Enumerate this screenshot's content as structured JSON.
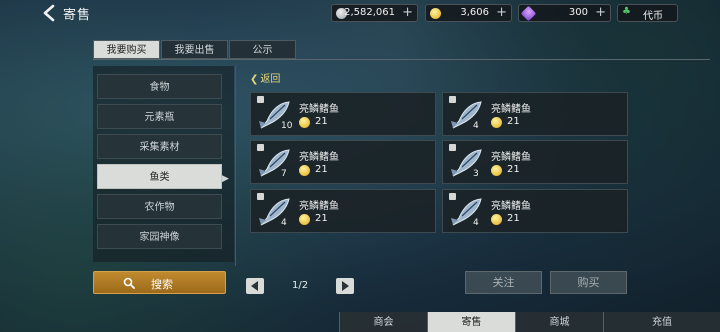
{
  "header": {
    "title": "寄售"
  },
  "currencies": [
    {
      "icon": "silver-coin-icon",
      "value": "2,582,061"
    },
    {
      "icon": "gold-coin-icon",
      "value": "3,606"
    },
    {
      "icon": "purple-gem-icon",
      "value": "300"
    },
    {
      "icon": "clover-icon",
      "value": "代币"
    }
  ],
  "tabs": [
    "我要购买",
    "我要出售",
    "公示"
  ],
  "categories": [
    "食物",
    "元素瓶",
    "采集素材",
    "鱼类",
    "农作物",
    "家园神像"
  ],
  "active_category": "鱼类",
  "search_label": "搜索",
  "return_label": "返回",
  "items": [
    {
      "name": "亮鳞鳍鱼",
      "price": "21",
      "qty": "10"
    },
    {
      "name": "亮鳞鳍鱼",
      "price": "21",
      "qty": "4"
    },
    {
      "name": "亮鳞鳍鱼",
      "price": "21",
      "qty": "7"
    },
    {
      "name": "亮鳞鳍鱼",
      "price": "21",
      "qty": "3"
    },
    {
      "name": "亮鳞鳍鱼",
      "price": "21",
      "qty": "4"
    },
    {
      "name": "亮鳞鳍鱼",
      "price": "21",
      "qty": "4"
    }
  ],
  "pagination": {
    "label": "1/2"
  },
  "actions": {
    "follow": "关注",
    "buy": "购买"
  },
  "bottom_nav": [
    "商会",
    "寄售",
    "商城",
    "充值"
  ],
  "active_nav": "寄售",
  "colors": {
    "accent_gold": "#c08a2e",
    "return_link": "#e6d67a",
    "active_tab": "#d9dcd9"
  }
}
